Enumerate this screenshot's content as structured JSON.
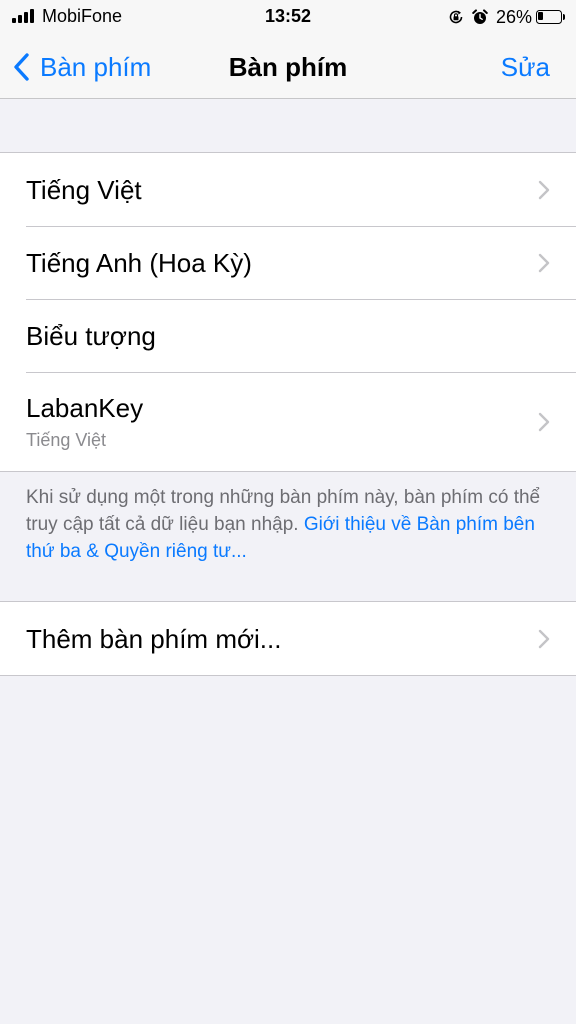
{
  "status_bar": {
    "carrier": "MobiFone",
    "time": "13:52",
    "battery_percent": "26%",
    "battery_level": 0.26,
    "signal_bars": 4,
    "icons": [
      "signal-icon",
      "rotation-lock-icon",
      "alarm-icon",
      "battery-icon"
    ]
  },
  "nav": {
    "back_label": "Bàn phím",
    "title": "Bàn phím",
    "edit_label": "Sửa"
  },
  "keyboards": [
    {
      "label": "Tiếng Việt",
      "subtitle": "",
      "has_chevron": true
    },
    {
      "label": "Tiếng Anh (Hoa Kỳ)",
      "subtitle": "",
      "has_chevron": true
    },
    {
      "label": "Biểu tượng",
      "subtitle": "",
      "has_chevron": false
    },
    {
      "label": "LabanKey",
      "subtitle": "Tiếng Việt",
      "has_chevron": true
    }
  ],
  "footer": {
    "text": "Khi sử dụng một trong những bàn phím này, bàn phím có thể truy cập tất cả dữ liệu bạn nhập.",
    "link": "Giới thiệu về Bàn phím bên thứ ba & Quyền riêng tư..."
  },
  "add_keyboard": {
    "label": "Thêm bàn phím mới...",
    "has_chevron": true
  },
  "colors": {
    "accent": "#0a7aff",
    "background": "#f2f2f7",
    "separator": "#c8c7cc",
    "secondary_text": "#8a8a8e"
  }
}
